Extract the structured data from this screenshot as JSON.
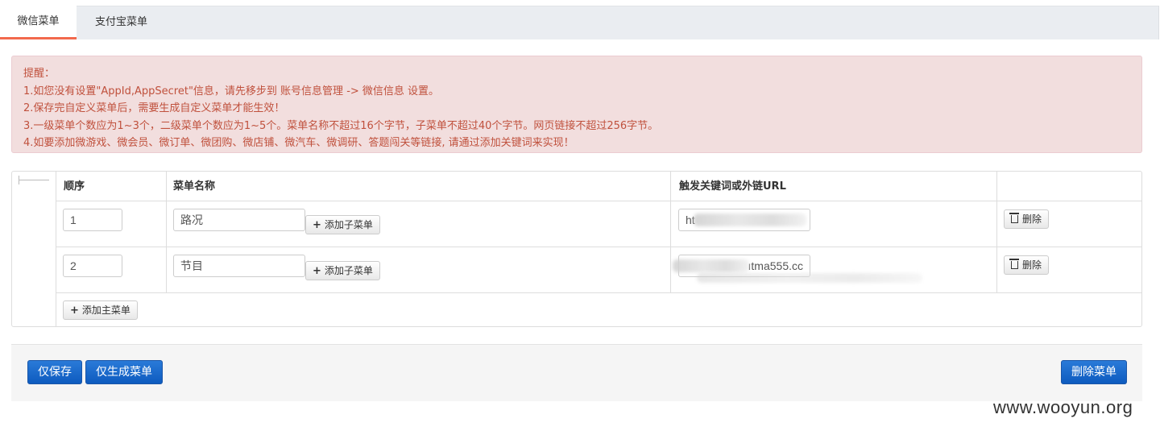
{
  "tabs": [
    {
      "label": "微信菜单",
      "active": true
    },
    {
      "label": "支付宝菜单",
      "active": false
    }
  ],
  "alert": {
    "title": "提醒：",
    "lines": [
      "1.如您没有设置\"AppId,AppSecret\"信息，请先移步到 账号信息管理 -> 微信信息 设置。",
      "2.保存完自定义菜单后，需要生成自定义菜单才能生效！",
      "3.一级菜单个数应为1~3个，二级菜单个数应为1~5个。菜单名称不超过16个字节，子菜单不超过40个字节。网页链接不超过256字节。",
      "4.如要添加微游戏、微会员、微订单、微团购、微店铺、微汽车、微调研、答题闯关等链接, 请通过添加关键词来实现！"
    ]
  },
  "table": {
    "headers": {
      "order": "顺序",
      "name": "菜单名称",
      "url": "触发关键词或外链URL"
    },
    "rows": [
      {
        "order": "1",
        "name": "路况",
        "url_visible": "ht",
        "add_sub": "添加子菜单",
        "delete": "删除"
      },
      {
        "order": "2",
        "name": "节目",
        "url_visible": "ıtma555.cc",
        "add_sub": "添加子菜单",
        "delete": "删除"
      }
    ],
    "add_main": "添加主菜单"
  },
  "footer": {
    "save_only": "仅保存",
    "generate_only": "仅生成菜单",
    "delete_menu": "删除菜单"
  },
  "watermark": "www.wooyun.org",
  "colors": {
    "accent_tab": "#f2694c",
    "alert_bg": "#f2dede",
    "alert_text": "#c0513d",
    "primary": "#0e5bbf"
  }
}
